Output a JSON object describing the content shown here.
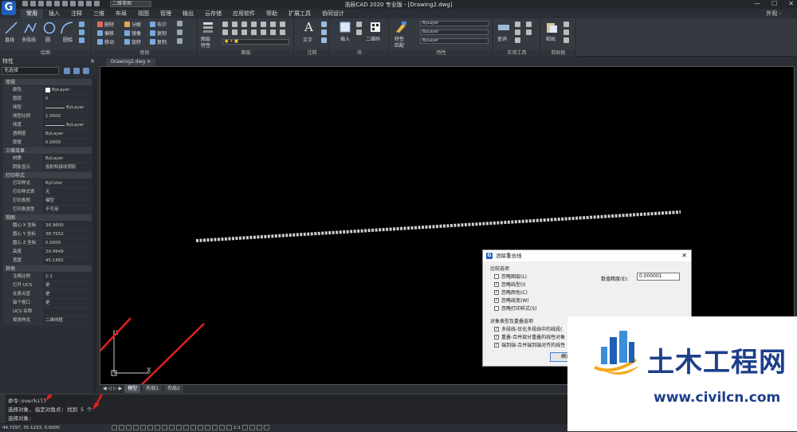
{
  "app": {
    "title": "浩辰CAD 2020 专业版 - [Drawing2.dwg]",
    "workspace": "二维草图",
    "look_label": "外观 -",
    "window_controls": [
      "—",
      "☐",
      "✕"
    ]
  },
  "ribbon_tabs": [
    "常用",
    "插入",
    "注释",
    "三维",
    "布局",
    "视图",
    "管理",
    "输出",
    "云存储",
    "应用软件",
    "帮助",
    "扩展工具",
    "协同设计"
  ],
  "ribbon": {
    "draw": {
      "label": "绘图",
      "items": [
        "直线",
        "多段线",
        "圆",
        "圆弧"
      ]
    },
    "modify": {
      "label": "修改",
      "items": [
        "删除",
        "分解",
        "布尔",
        "偏移",
        "镜像",
        "复制",
        "移动",
        "旋转",
        "复制"
      ]
    },
    "layer": {
      "label": "图层",
      "items": [
        "图层",
        "特性"
      ]
    },
    "annot": {
      "label": "注释",
      "items": [
        "文字"
      ]
    },
    "block": {
      "label": "块",
      "items": [
        "插入",
        "二维码"
      ]
    },
    "props": {
      "label": "特性",
      "items": [
        "特性",
        "匹配"
      ],
      "combos": [
        "ByLayer",
        "ByLayer",
        "ByLayer"
      ]
    },
    "util": {
      "label": "实用工具",
      "items": [
        "查询"
      ]
    },
    "clip": {
      "label": "剪贴板",
      "items": [
        "粘贴"
      ]
    }
  },
  "palette": {
    "title": "特性",
    "selection": "无选择",
    "sections": [
      {
        "name": "常规",
        "rows": [
          {
            "k": "颜色",
            "v": "ByLayer",
            "sw": true
          },
          {
            "k": "图层",
            "v": "0"
          },
          {
            "k": "线型",
            "v": "ByLayer",
            "line": true
          },
          {
            "k": "线型比例",
            "v": "1.0000"
          },
          {
            "k": "线宽",
            "v": "ByLayer",
            "line": true
          },
          {
            "k": "透明度",
            "v": "ByLayer"
          },
          {
            "k": "厚度",
            "v": "0.0000"
          }
        ]
      },
      {
        "name": "三维效果",
        "rows": [
          {
            "k": "材质",
            "v": "ByLayer"
          },
          {
            "k": "阴影显示",
            "v": "投射和接收阴影"
          }
        ]
      },
      {
        "name": "打印样式",
        "rows": [
          {
            "k": "打印样式",
            "v": "ByColor"
          },
          {
            "k": "打印样式表",
            "v": "无"
          },
          {
            "k": "打印表附",
            "v": "模型"
          },
          {
            "k": "打印表类型",
            "v": "不可用"
          }
        ]
      },
      {
        "name": "视图",
        "rows": [
          {
            "k": "圆心 X 坐标",
            "v": "36.9600"
          },
          {
            "k": "圆心 Y 坐标",
            "v": "38.7552"
          },
          {
            "k": "圆心 Z 坐标",
            "v": "0.0000"
          },
          {
            "k": "高度",
            "v": "20.4949"
          },
          {
            "k": "宽度",
            "v": "45.1482"
          }
        ]
      },
      {
        "name": "其他",
        "rows": [
          {
            "k": "注释比例",
            "v": "1:1"
          },
          {
            "k": "打开 UCS",
            "v": "是"
          },
          {
            "k": "在原点显",
            "v": "是"
          },
          {
            "k": "每个视口",
            "v": "是"
          },
          {
            "k": "UCS 名称",
            "v": ""
          },
          {
            "k": "视觉样式",
            "v": "二维线框"
          }
        ]
      }
    ]
  },
  "document": {
    "tab": "Drawing2.dwg",
    "layout_tabs": [
      "模型",
      "布局1",
      "布局2"
    ]
  },
  "command": {
    "lines": [
      "命令:overkill",
      "选择对象, 指定对角点: 找到 5 个",
      "选择对象:"
    ]
  },
  "status": {
    "coords": "44.7297, 35.1233, 0.0000",
    "scale": "1:1"
  },
  "dialog": {
    "title": "消除重合线",
    "compare_label": "比较选项",
    "checks": [
      {
        "label": "忽略图层(L)",
        "checked": false
      },
      {
        "label": "忽略线型(I)",
        "checked": true
      },
      {
        "label": "忽略颜色(C)",
        "checked": true
      },
      {
        "label": "忽略线宽(W)",
        "checked": true
      },
      {
        "label": "忽略打印样式(S)",
        "checked": false
      }
    ],
    "tolerance_label": "数值精度(E):",
    "tolerance_value": "0.000001",
    "object_label": "对象类型及重叠选项",
    "options": [
      {
        "label": "多段线-优化多段线中的线段(",
        "checked": true
      },
      {
        "label": "重叠-合并部分重叠的线性对象",
        "checked": true
      },
      {
        "label": "端到端-合并端到端对齐的线性",
        "checked": true
      }
    ],
    "ok": "确定"
  },
  "watermark": {
    "name": "土木工程网",
    "url": "www.civilcn.com"
  },
  "colors": {
    "accent": "#1f5fbf",
    "arrow": "#e0201c",
    "watermark": "#1d3f8a"
  }
}
